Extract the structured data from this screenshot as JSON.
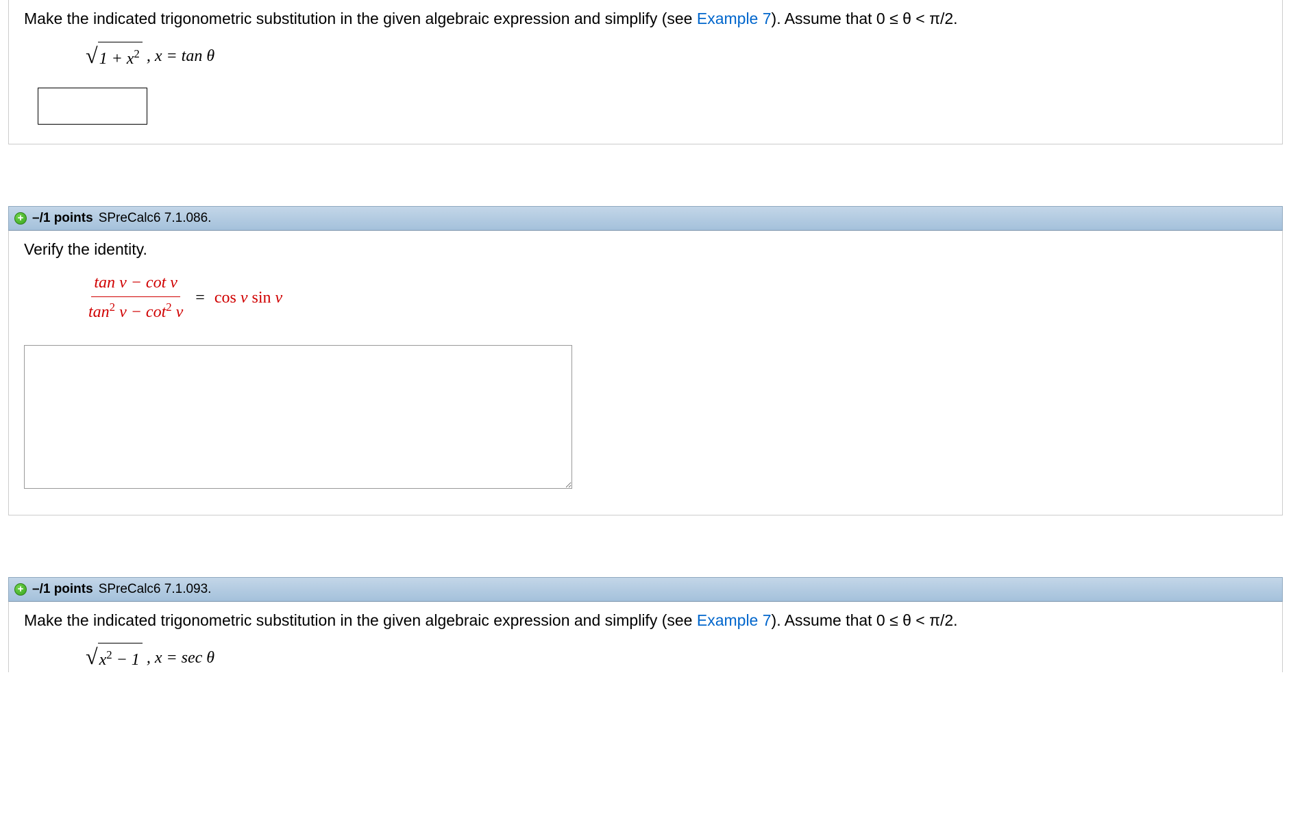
{
  "q1": {
    "prompt_prefix": "Make the indicated trigonometric substitution in the given algebraic expression and simplify (see ",
    "example_link": "Example 7",
    "prompt_suffix": "). Assume that  0 ≤ θ < π/2.",
    "sqrt_expr": "1 + x",
    "sqrt_sup": "2",
    "sub_expr": ",   x = tan θ"
  },
  "q2": {
    "expand": "+",
    "points": "–/1 points",
    "ref": "SPreCalc6 7.1.086.",
    "prompt": "Verify the identity.",
    "frac_num_a": "tan ",
    "frac_num_var": "v",
    "frac_num_b": " − cot ",
    "frac_den_a": "tan",
    "frac_den_sup": "2",
    "frac_den_b": " − cot",
    "eq_mid": " = ",
    "rhs_a": "cos ",
    "rhs_b": " sin "
  },
  "q3": {
    "expand": "+",
    "points": "–/1 points",
    "ref": "SPreCalc6 7.1.093.",
    "prompt_prefix": "Make the indicated trigonometric substitution in the given algebraic expression and simplify (see ",
    "example_link": "Example 7",
    "prompt_suffix": "). Assume that  0 ≤ θ < π/2.",
    "sqrt_expr_a": "x",
    "sqrt_sup": "2",
    "sqrt_expr_b": " − 1",
    "sub_expr": ",   x = sec θ"
  }
}
